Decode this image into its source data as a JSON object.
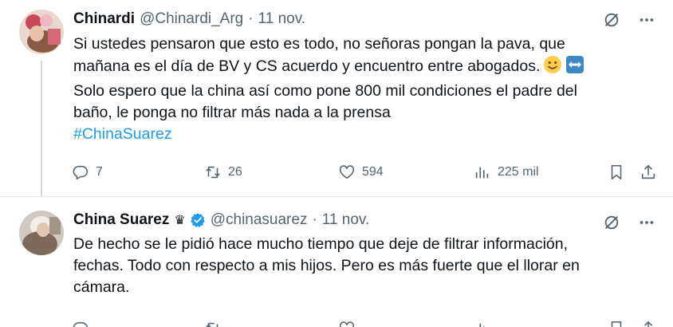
{
  "tweets": [
    {
      "name": "Chinardi",
      "handle": "@Chinardi_Arg",
      "separator": "·",
      "date": "11 nov.",
      "lines": [
        "Si ustedes pensaron que esto es todo, no señoras pongan la pava, que",
        "mañana es el día de BV y CS acuerdo y encuentro entre abogados.",
        "Solo espero que la china así como pone 800 mil condiciones el padre del",
        "baño, le ponga no filtrar más nada a la prensa"
      ],
      "hashtag": "#ChinaSuarez",
      "emojis": [
        "slightly-smiling-face",
        "left-right-arrow"
      ],
      "stats": {
        "replies": "7",
        "reposts": "26",
        "likes": "594",
        "views": "225 mil"
      }
    },
    {
      "name": "China Suarez",
      "badge": "♛",
      "handle": "@chinasuarez",
      "separator": "·",
      "date": "11 nov.",
      "verified": true,
      "lines": [
        "De hecho se le pidió hace mucho tiempo que deje de filtrar información,",
        "fechas. Todo con respecto a mis hijos. Pero es más fuerte que el llorar en",
        "cámara."
      ]
    }
  ],
  "colors": {
    "accent": "#1d9bf0",
    "text": "#0f1419",
    "muted": "#536471",
    "divider": "#e6e9ec"
  },
  "icons": [
    "reply-icon",
    "repost-icon",
    "like-icon",
    "views-icon",
    "bookmark-icon",
    "share-icon",
    "grok-icon",
    "more-icon",
    "verified-badge-icon"
  ]
}
